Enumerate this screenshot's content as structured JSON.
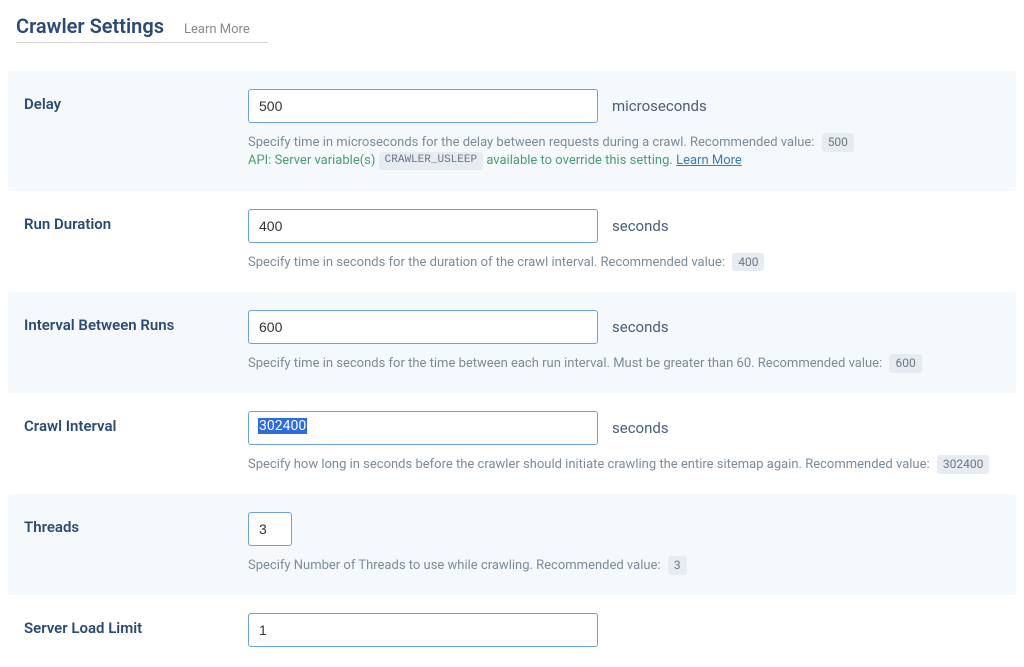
{
  "header": {
    "title": "Crawler Settings",
    "learn_more": "Learn More"
  },
  "settings": {
    "delay": {
      "label": "Delay",
      "value": "500",
      "unit": "microseconds",
      "help_main": "Specify time in microseconds for the delay between requests during a crawl. Recommended value:",
      "recommended": "500",
      "api_pre": "API: Server variable(s)",
      "api_var": "CRAWLER_USLEEP",
      "api_post": "available to override this setting.",
      "api_link": "Learn More"
    },
    "run_duration": {
      "label": "Run Duration",
      "value": "400",
      "unit": "seconds",
      "help_main": "Specify time in seconds for the duration of the crawl interval. Recommended value:",
      "recommended": "400"
    },
    "interval_between": {
      "label": "Interval Between Runs",
      "value": "600",
      "unit": "seconds",
      "help_main": "Specify time in seconds for the time between each run interval. Must be greater than 60. Recommended value:",
      "recommended": "600"
    },
    "crawl_interval": {
      "label": "Crawl Interval",
      "value": "302400",
      "unit": "seconds",
      "help_main": "Specify how long in seconds before the crawler should initiate crawling the entire sitemap again. Recommended value:",
      "recommended": "302400"
    },
    "threads": {
      "label": "Threads",
      "value": "3",
      "unit": "",
      "help_main": "Specify Number of Threads to use while crawling. Recommended value:",
      "recommended": "3"
    },
    "server_load": {
      "label": "Server Load Limit",
      "value": "1",
      "unit": ""
    }
  }
}
